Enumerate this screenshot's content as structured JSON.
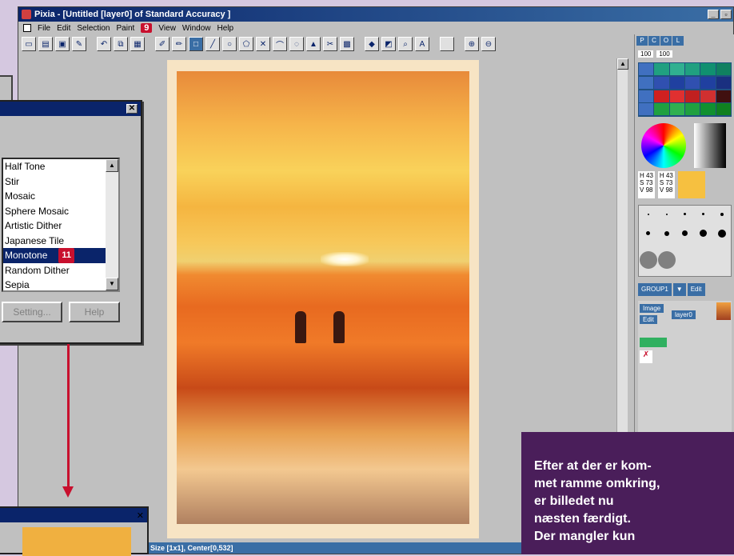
{
  "window": {
    "title": "Pixia - [Untitled [layer0] of Standard Accuracy ]"
  },
  "menu": {
    "items": [
      "File",
      "Edit",
      "Selection",
      "Paint",
      "View",
      "Window",
      "Help"
    ],
    "badge": "9"
  },
  "filter_dialog": {
    "items": [
      "Half Tone",
      "Stir",
      "Mosaic",
      "Sphere Mosaic",
      "Artistic Dither",
      "Japanese Tile",
      "Monotone",
      "Random Dither",
      "Sepia"
    ],
    "selected_index": 6,
    "selected_badge": "11",
    "setting_button": "Setting...",
    "help_button": "Help"
  },
  "panel": {
    "tabs": [
      "P",
      "C",
      "O",
      "L"
    ],
    "rgb": {
      "h": "43",
      "s": "73",
      "v": "98",
      "h2": "43",
      "s2": "73",
      "v2": "98"
    },
    "opacity_a": "100",
    "opacity_b": "100",
    "group_label": "GROUP1",
    "edit_label": "Edit",
    "image_label": "Image",
    "layer_name": "layer0"
  },
  "status": {
    "text": ", Size [1x1], Center[0,532]"
  },
  "callout": {
    "text": "Efter at der er kom-\nmet ramme omkring,\ner billedet nu\nnæsten færdigt.\nDer mangler kun"
  },
  "colors": {
    "accent": "#c8102e",
    "title_blue": "#0a246a",
    "callout_bg": "#4a1e5a"
  }
}
